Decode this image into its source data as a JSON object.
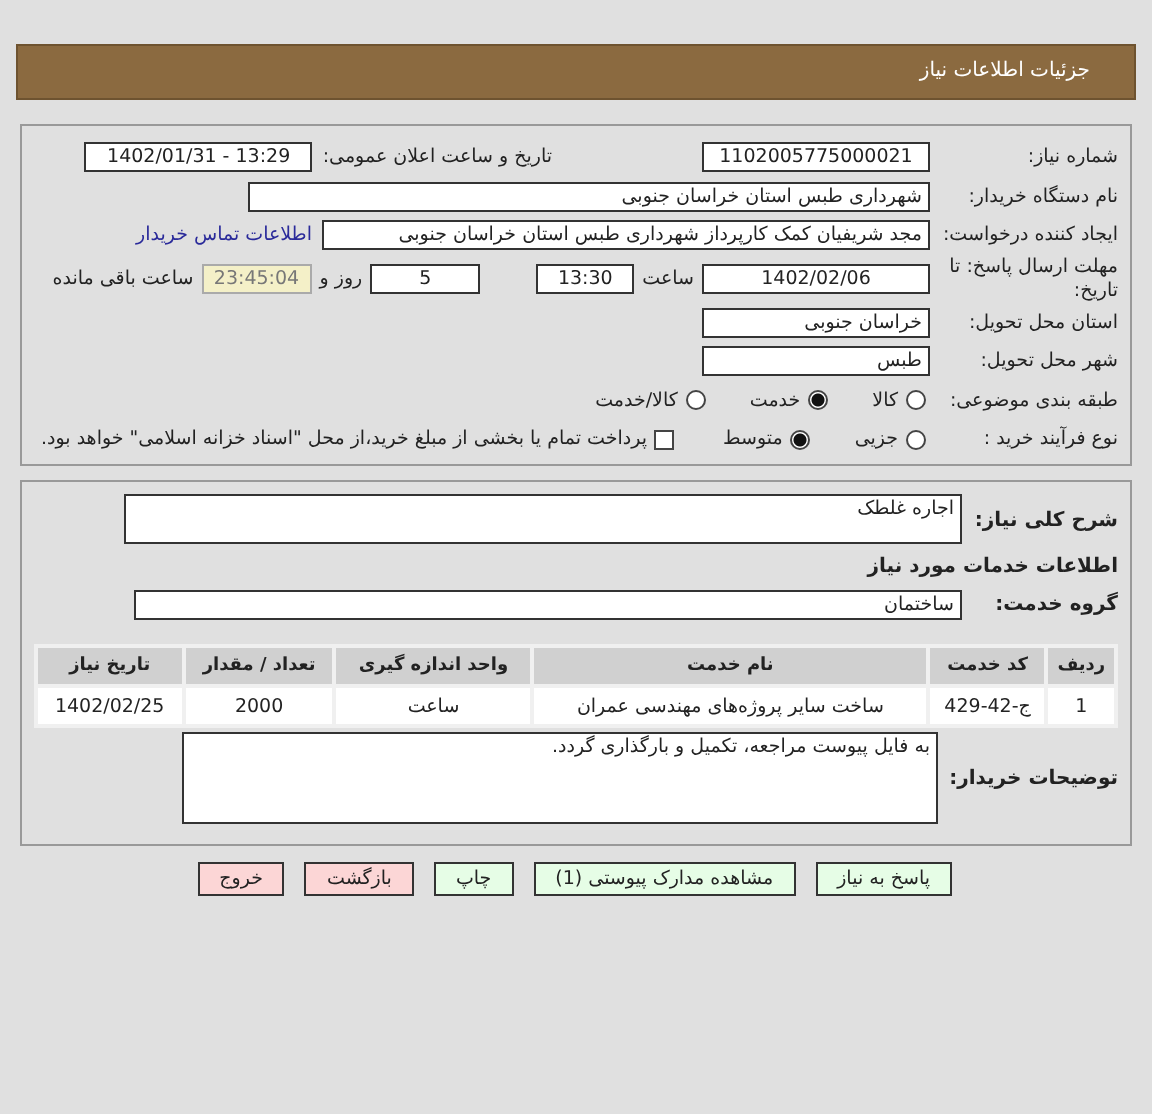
{
  "header": {
    "title": "جزئیات اطلاعات نیاز"
  },
  "need_number": {
    "label": "شماره نیاز:",
    "value": "1102005775000021"
  },
  "announce": {
    "label": "تاریخ و ساعت اعلان عمومی:",
    "value": "1402/01/31 - 13:29"
  },
  "buyer": {
    "label": "نام دستگاه خریدار:",
    "value": "شهرداری طبس استان خراسان جنوبی"
  },
  "creator": {
    "label": "ایجاد کننده درخواست:",
    "value": "مجد شریفیان کمک کارپرداز شهرداری طبس استان خراسان جنوبی",
    "link": "اطلاعات تماس خریدار"
  },
  "deadline": {
    "label": "مهلت ارسال پاسخ: تا تاریخ:",
    "date": "1402/02/06",
    "time_label": "ساعت",
    "time": "13:30",
    "days": "5",
    "days_label": "روز و",
    "remaining": "23:45:04",
    "remaining_label": "ساعت باقی مانده"
  },
  "province": {
    "label": "استان محل تحویل:",
    "value": "خراسان جنوبی"
  },
  "city": {
    "label": "شهر محل تحویل:",
    "value": "طبس"
  },
  "category": {
    "label": "طبقه بندی موضوعی:",
    "options": [
      {
        "label": "کالا",
        "selected": false
      },
      {
        "label": "خدمت",
        "selected": true
      },
      {
        "label": "کالا/خدمت",
        "selected": false
      }
    ]
  },
  "process": {
    "label": "نوع فرآیند خرید :",
    "options": [
      {
        "label": "جزیی",
        "selected": false
      },
      {
        "label": "متوسط",
        "selected": true
      }
    ],
    "payment": {
      "checked": false,
      "text": "پرداخت تمام یا بخشی از مبلغ خرید،از محل \"اسناد خزانه اسلامی\" خواهد بود."
    }
  },
  "description": {
    "label": "شرح کلی نیاز:",
    "value": "اجاره غلطک"
  },
  "services_title": "اطلاعات خدمات مورد نیاز",
  "service_group": {
    "label": "گروه خدمت:",
    "value": "ساختمان"
  },
  "table": {
    "columns": [
      "ردیف",
      "کد خدمت",
      "نام خدمت",
      "واحد اندازه گیری",
      "تعداد / مقدار",
      "تاریخ نیاز"
    ],
    "rows": [
      [
        "1",
        "ج-42-429",
        "ساخت سایر پروژه‌های مهندسی عمران",
        "ساعت",
        "2000",
        "1402/02/25"
      ]
    ]
  },
  "notes": {
    "label": "توضیحات خریدار:",
    "value": "به فایل پیوست مراجعه، تکمیل و بارگذاری گردد."
  },
  "buttons": [
    {
      "label": "پاسخ به نیاز",
      "kind": "confirm"
    },
    {
      "label": "مشاهده مدارک پیوستی (1)",
      "kind": "confirm"
    },
    {
      "label": "چاپ",
      "kind": "confirm"
    },
    {
      "label": "بازگشت",
      "kind": "cancel"
    },
    {
      "label": "خروج",
      "kind": "cancel"
    }
  ]
}
